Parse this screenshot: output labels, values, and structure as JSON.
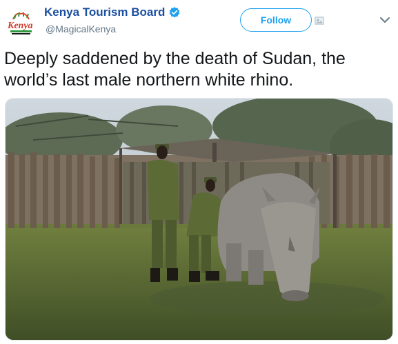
{
  "tweet": {
    "account": {
      "display_name": "Kenya Tourism Board",
      "handle": "@MagicalKenya",
      "verified": true,
      "avatar_logo_text": "Kenya"
    },
    "follow_label": "Follow",
    "text": "Deeply saddened by the death of Sudan, the world’s last male northern white rhino."
  },
  "icons": {
    "verified": "verified-badge-icon",
    "follow_add": "add-user-icon",
    "more": "chevron-down-icon"
  },
  "colors": {
    "link_blue": "#1b4fa0",
    "accent": "#1da1f2",
    "text": "#14171a",
    "muted": "#657786"
  }
}
